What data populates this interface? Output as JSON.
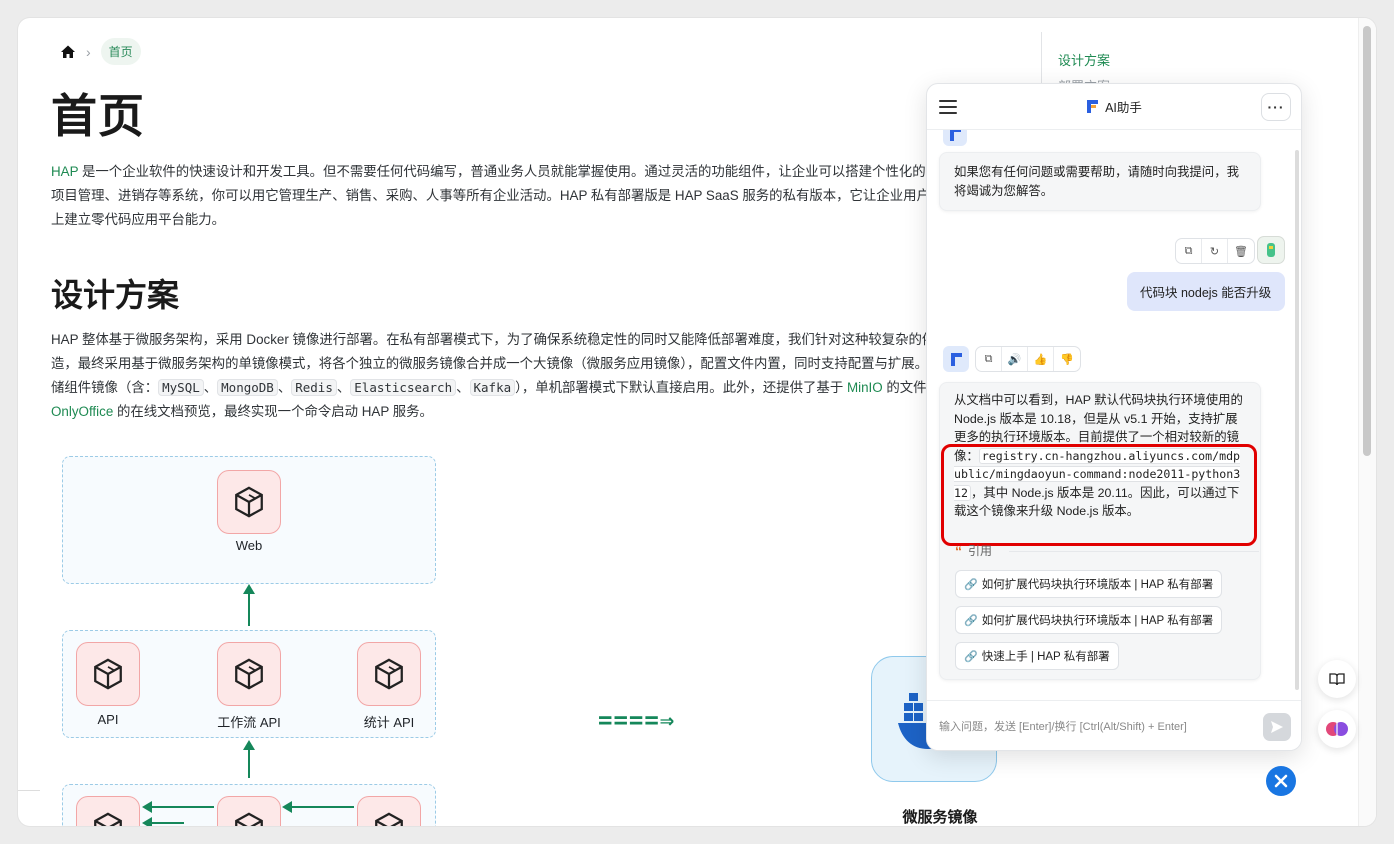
{
  "breadcrumb": {
    "current": "首页"
  },
  "page": {
    "title": "首页",
    "intro_link": "HAP",
    "intro_text": " 是一个企业软件的快速设计和开发工具。但不需要任何代码编写，普通业务人员就能掌握使用。通过灵活的功能组件，让企业可以搭建个性化的 CRM、ERP、OA、项目管理、进销存等系统，你可以用它管理生产、销售、采购、人事等所有企业活动。HAP 私有部署版是 HAP SaaS 服务的私有版本，它让企业用户在自己的云计算设施上建立零代码应用平台能力。",
    "section_title": "设计方案",
    "design_text_1": "HAP 整体基于微服务架构，采用 Docker 镜像进行部署。在私有部署模式下，为了确保系统稳定性的同时又能降低部署难度，我们针对这种较复杂的依赖关系进行了改造，最终采用基于微服务架构的单镜像模式，将各个独立的微服务镜像合并成一个大镜像（微服务应用镜像），配置文件内置，同时支持配置与扩展。同时也提供了数据存储组件镜像（含：",
    "design_codes": [
      "MySQL",
      "MongoDB",
      "Redis",
      "Elasticsearch",
      "Kafka"
    ],
    "design_sep": "、",
    "design_text_2": "），单机部署模式下默认直接启用。此外，还提供了基于 ",
    "design_link_1": "MinIO",
    "design_text_3": " 的文件对象存储 和 基于 ",
    "design_link_2": "OnlyOffice",
    "design_text_4": " 的在线文档预览，最终实现一个命令启动 HAP 服务。"
  },
  "toc": {
    "active": "设计方案",
    "next": "部署方案"
  },
  "diagram": {
    "web_label": "Web",
    "api_labels": [
      "API",
      "工作流 API",
      "统计 API"
    ],
    "arrow_text": "====⇒",
    "image_label": "微服务镜像"
  },
  "ai": {
    "title": "AI助手",
    "more": "···",
    "greeting": "如果您有任何问题或需要帮助，请随时向我提问，我将竭诚为您解答。",
    "user_message": "代码块 nodejs 能否升级",
    "answer_part1": "从文档中可以看到，HAP 默认代码块执行环境使用的 Node.js 版本是 10.18，但是从 v5.1 开始，支持扩展更多的执行环境版本。目前提供了一个相对较新的镜像：",
    "answer_code": "registry.cn-hangzhou.aliyuncs.com/mdpublic/mingdaoyun-command:node2011-python312",
    "answer_part2": "，其中 Node.js 版本是 20.11。因此，可以通过下载这个镜像来升级 Node.js 版本。",
    "ref_label": "引用",
    "refs": [
      "如何扩展代码块执行环境版本 | HAP 私有部署",
      "如何扩展代码块执行环境版本 | HAP 私有部署",
      "快速上手 | HAP 私有部署"
    ],
    "input_placeholder": "输入问题，发送 [Enter]/换行 [Ctrl(Alt/Shift) + Enter]"
  },
  "colors": {
    "accent": "#1e8a52",
    "highlight": "#e10000",
    "user_bubble": "#dfe6fb",
    "fab": "#1976e2"
  }
}
